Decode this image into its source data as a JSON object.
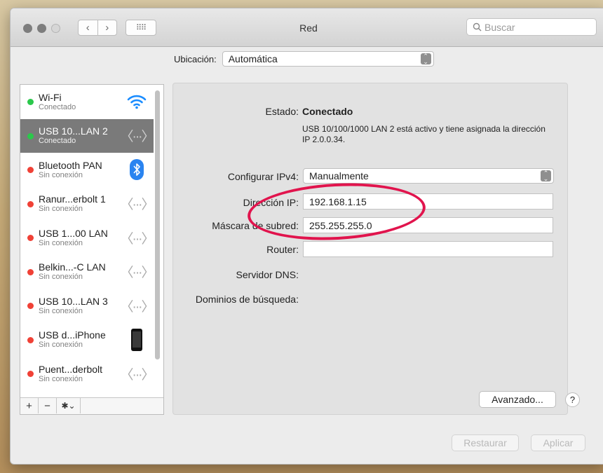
{
  "window": {
    "title": "Red"
  },
  "toolbar": {
    "back": "‹",
    "forward": "›",
    "grid": "⠿⠿",
    "search_placeholder": "Buscar",
    "search_icon": "🔍"
  },
  "location": {
    "label": "Ubicación:",
    "value": "Automática"
  },
  "services": [
    {
      "name": "Wi-Fi",
      "status": "Conectado",
      "state": "green",
      "icon": "wifi-icon"
    },
    {
      "name": "USB 10...LAN 2",
      "status": "Conectado",
      "state": "green",
      "icon": "ethernet-icon",
      "active": true
    },
    {
      "name": "Bluetooth PAN",
      "status": "Sin conexión",
      "state": "red",
      "icon": "bluetooth-icon"
    },
    {
      "name": "Ranur...erbolt 1",
      "status": "Sin conexión",
      "state": "red",
      "icon": "ethernet-icon"
    },
    {
      "name": "USB 1...00 LAN",
      "status": "Sin conexión",
      "state": "red",
      "icon": "ethernet-icon"
    },
    {
      "name": "Belkin...-C LAN",
      "status": "Sin conexión",
      "state": "red",
      "icon": "ethernet-icon"
    },
    {
      "name": "USB 10...LAN 3",
      "status": "Sin conexión",
      "state": "red",
      "icon": "ethernet-icon"
    },
    {
      "name": "USB d...iPhone",
      "status": "Sin conexión",
      "state": "red",
      "icon": "iphone-icon"
    },
    {
      "name": "Puent...derbolt",
      "status": "Sin conexión",
      "state": "red",
      "icon": "ethernet-icon"
    }
  ],
  "sidebar_footer": {
    "add": "+",
    "remove": "−",
    "gear": "✱⌄"
  },
  "detail": {
    "estado_label": "Estado:",
    "estado_value": "Conectado",
    "description": "USB 10/100/1000 LAN 2 está activo y tiene asignada la dirección IP 2.0.0.34.",
    "ipv4_label": "Configurar IPv4:",
    "ipv4_value": "Manualmente",
    "ip_label": "Dirección IP:",
    "ip_value": "192.168.1.15",
    "mask_label": "Máscara de subred:",
    "mask_value": "255.255.255.0",
    "router_label": "Router:",
    "router_value": "",
    "dns_label": "Servidor DNS:",
    "search_domains_label": "Dominios de búsqueda:"
  },
  "buttons": {
    "advanced": "Avanzado...",
    "help": "?",
    "revert": "Restaurar",
    "apply": "Aplicar"
  },
  "colors": {
    "connected": "#2bc84b",
    "disconnected": "#f04136",
    "annotation": "#e1144d",
    "wifi": "#1a8cff",
    "bluetooth": "#2a84f0"
  }
}
